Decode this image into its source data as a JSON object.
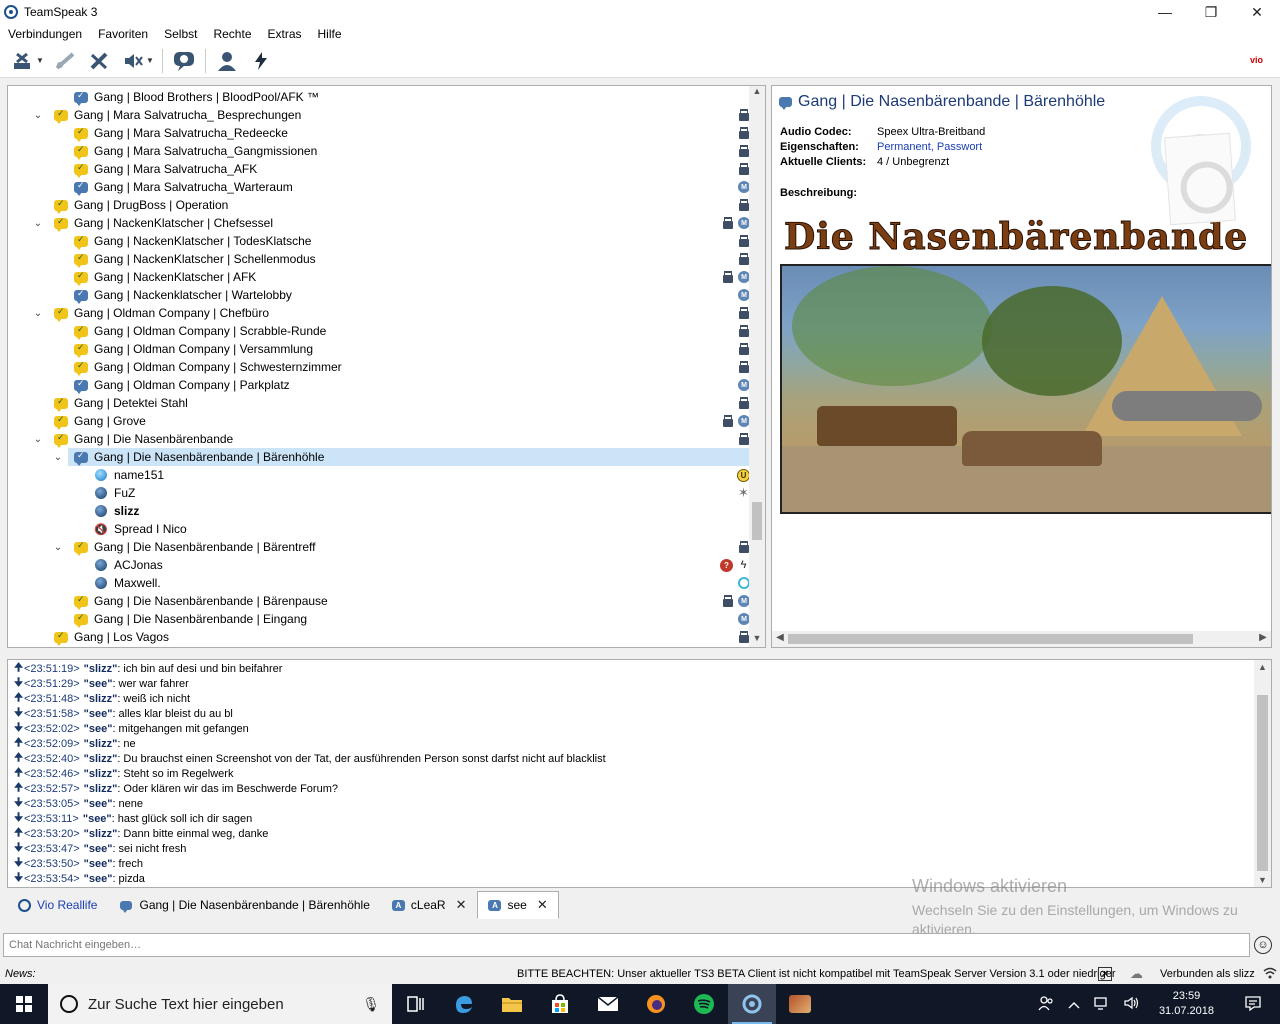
{
  "window": {
    "title": "TeamSpeak 3",
    "minimize": "—",
    "maximize": "❐",
    "close": "✕"
  },
  "menu": [
    "Verbindungen",
    "Favoriten",
    "Selbst",
    "Rechte",
    "Extras",
    "Hilfe"
  ],
  "toolbar": {
    "icons": [
      "disconnect-icon",
      "server-connect-icon",
      "mute-microphone-icon",
      "mute-speakers-icon",
      "away-icon",
      "contacts-icon",
      "whisper-icon"
    ],
    "logo_text": "vio"
  },
  "tree": {
    "rows": [
      {
        "kind": "channel",
        "label": "Gang | Blood Brothers | BloodPool/AFK ™",
        "level": 2,
        "icon": "blue",
        "toggle": "",
        "flags": []
      },
      {
        "kind": "channel",
        "label": "Gang | Mara Salvatrucha_ Besprechungen",
        "level": 1,
        "icon": "yellow",
        "toggle": "⌄",
        "flags": [
          "lock"
        ]
      },
      {
        "kind": "channel",
        "label": "Gang | Mara Salvatrucha_Redeecke",
        "level": 2,
        "icon": "yellow",
        "toggle": "",
        "flags": [
          "lock"
        ]
      },
      {
        "kind": "channel",
        "label": "Gang | Mara Salvatrucha_Gangmissionen",
        "level": 2,
        "icon": "yellow",
        "toggle": "",
        "flags": [
          "lock"
        ]
      },
      {
        "kind": "channel",
        "label": "Gang | Mara Salvatrucha_AFK",
        "level": 2,
        "icon": "yellow",
        "toggle": "",
        "flags": [
          "lock"
        ]
      },
      {
        "kind": "channel",
        "label": "Gang | Mara Salvatrucha_Warteraum",
        "level": 2,
        "icon": "blue",
        "toggle": "",
        "flags": [
          "mod"
        ]
      },
      {
        "kind": "channel",
        "label": "Gang | DrugBoss | Operation",
        "level": 1,
        "icon": "yellow",
        "toggle": "",
        "flags": [
          "lock"
        ]
      },
      {
        "kind": "channel",
        "label": "Gang | NackenKlatscher | Chefsessel",
        "level": 1,
        "icon": "yellow",
        "toggle": "⌄",
        "flags": [
          "lock",
          "mod"
        ]
      },
      {
        "kind": "channel",
        "label": "Gang | NackenKlatscher | TodesKlatsche",
        "level": 2,
        "icon": "yellow",
        "toggle": "",
        "flags": [
          "lock"
        ]
      },
      {
        "kind": "channel",
        "label": "Gang | NackenKlatscher | Schellenmodus",
        "level": 2,
        "icon": "yellow",
        "toggle": "",
        "flags": [
          "lock"
        ]
      },
      {
        "kind": "channel",
        "label": "Gang | NackenKlatscher | AFK",
        "level": 2,
        "icon": "yellow",
        "toggle": "",
        "flags": [
          "lock",
          "mod"
        ]
      },
      {
        "kind": "channel",
        "label": "Gang | Nackenklatscher | Wartelobby",
        "level": 2,
        "icon": "blue",
        "toggle": "",
        "flags": [
          "mod"
        ]
      },
      {
        "kind": "channel",
        "label": "Gang | Oldman Company | Chefbüro",
        "level": 1,
        "icon": "yellow",
        "toggle": "⌄",
        "flags": [
          "lock"
        ]
      },
      {
        "kind": "channel",
        "label": "Gang | Oldman Company | Scrabble-Runde",
        "level": 2,
        "icon": "yellow",
        "toggle": "",
        "flags": [
          "lock"
        ]
      },
      {
        "kind": "channel",
        "label": "Gang | Oldman Company | Versammlung",
        "level": 2,
        "icon": "yellow",
        "toggle": "",
        "flags": [
          "lock"
        ]
      },
      {
        "kind": "channel",
        "label": "Gang | Oldman Company | Schwesternzimmer",
        "level": 2,
        "icon": "yellow",
        "toggle": "",
        "flags": [
          "lock"
        ]
      },
      {
        "kind": "channel",
        "label": "Gang | Oldman Company | Parkplatz",
        "level": 2,
        "icon": "blue",
        "toggle": "",
        "flags": [
          "mod"
        ]
      },
      {
        "kind": "channel",
        "label": "Gang | Detektei Stahl",
        "level": 1,
        "icon": "yellow",
        "toggle": "",
        "flags": [
          "lock"
        ]
      },
      {
        "kind": "channel",
        "label": "Gang | Grove",
        "level": 1,
        "icon": "yellow",
        "toggle": "",
        "flags": [
          "lock",
          "mod"
        ]
      },
      {
        "kind": "channel",
        "label": "Gang | Die Nasenbärenbande",
        "level": 1,
        "icon": "yellow",
        "toggle": "⌄",
        "flags": [
          "lock"
        ]
      },
      {
        "kind": "channel",
        "label": "Gang | Die Nasenbärenbande | Bärenhöhle",
        "level": 2,
        "icon": "blue",
        "toggle": "⌄",
        "flags": [
          "lock"
        ],
        "selected": true
      },
      {
        "kind": "user",
        "label": "name151",
        "level": 3,
        "icon": "active",
        "bold": false,
        "flags": [
          "cmd"
        ]
      },
      {
        "kind": "user",
        "label": "FuZ",
        "level": 3,
        "icon": "normal",
        "bold": false,
        "flags": [
          "star"
        ]
      },
      {
        "kind": "user",
        "label": "slizz",
        "level": 3,
        "icon": "normal",
        "bold": true,
        "flags": []
      },
      {
        "kind": "user",
        "label": "Spread I Nico",
        "level": 3,
        "icon": "away",
        "bold": false,
        "flags": []
      },
      {
        "kind": "channel",
        "label": "Gang | Die Nasenbärenbande | Bärentreff",
        "level": 2,
        "icon": "yellow",
        "toggle": "⌄",
        "flags": [
          "lock"
        ]
      },
      {
        "kind": "user",
        "label": "ACJonas",
        "level": 3,
        "icon": "normal",
        "bold": false,
        "flags": [
          "red",
          "bolt"
        ]
      },
      {
        "kind": "user",
        "label": "Maxwell.",
        "level": 3,
        "icon": "normal",
        "bold": false,
        "flags": [
          "cyan"
        ]
      },
      {
        "kind": "channel",
        "label": "Gang | Die Nasenbärenbande | Bärenpause",
        "level": 2,
        "icon": "yellow",
        "toggle": "",
        "flags": [
          "lock",
          "mod"
        ]
      },
      {
        "kind": "channel",
        "label": "Gang | Die Nasenbärenbande | Eingang",
        "level": 2,
        "icon": "yellow",
        "toggle": "",
        "flags": [
          "mod"
        ]
      },
      {
        "kind": "channel",
        "label": "Gang | Los Vagos",
        "level": 1,
        "icon": "yellow",
        "toggle": "",
        "flags": [
          "lock"
        ]
      }
    ]
  },
  "info": {
    "channel_title": "Gang | Die Nasenbärenbande | Bärenhöhle",
    "audio_codec_label": "Audio Codec:",
    "audio_codec_value": "Speex Ultra-Breitband",
    "properties_label": "Eigenschaften:",
    "properties_value": "Permanent, Passwort",
    "clients_label": "Aktuelle Clients:",
    "clients_value": "4 / Unbegrenzt",
    "description_label": "Beschreibung:",
    "banner_text": "Die Nasenbärenbande"
  },
  "chat": {
    "messages": [
      {
        "dir": "out",
        "time": "<23:51:19>",
        "who": "\"slizz\"",
        "text": "ich bin auf desi und bin beifahrer"
      },
      {
        "dir": "in",
        "time": "<23:51:29>",
        "who": "\"see\"",
        "text": "wer war fahrer"
      },
      {
        "dir": "out",
        "time": "<23:51:48>",
        "who": "\"slizz\"",
        "text": "weiß ich nicht"
      },
      {
        "dir": "in",
        "time": "<23:51:58>",
        "who": "\"see\"",
        "text": "alles klar bleist du au bl"
      },
      {
        "dir": "in",
        "time": "<23:52:02>",
        "who": "\"see\"",
        "text": "mitgehangen mit gefangen"
      },
      {
        "dir": "out",
        "time": "<23:52:09>",
        "who": "\"slizz\"",
        "text": "ne"
      },
      {
        "dir": "out",
        "time": "<23:52:40>",
        "who": "\"slizz\"",
        "text": "Du brauchst einen Screenshot von der Tat, der ausführenden Person sonst darfst nicht auf blacklist"
      },
      {
        "dir": "out",
        "time": "<23:52:46>",
        "who": "\"slizz\"",
        "text": "Steht so im Regelwerk"
      },
      {
        "dir": "out",
        "time": "<23:52:57>",
        "who": "\"slizz\"",
        "text": "Oder klären wir das im Beschwerde Forum?"
      },
      {
        "dir": "in",
        "time": "<23:53:05>",
        "who": "\"see\"",
        "text": "nene"
      },
      {
        "dir": "in",
        "time": "<23:53:11>",
        "who": "\"see\"",
        "text": "hast glück soll ich dir sagen"
      },
      {
        "dir": "out",
        "time": "<23:53:20>",
        "who": "\"slizz\"",
        "text": "Dann bitte einmal weg, danke"
      },
      {
        "dir": "in",
        "time": "<23:53:47>",
        "who": "\"see\"",
        "text": "sei nicht fresh"
      },
      {
        "dir": "in",
        "time": "<23:53:50>",
        "who": "\"see\"",
        "text": "frech"
      },
      {
        "dir": "in",
        "time": "<23:53:54>",
        "who": "\"see\"",
        "text": "pizda"
      }
    ],
    "arrow_out": "🠉",
    "arrow_in": "🠋"
  },
  "watermark": {
    "line1": "Windows aktivieren",
    "line2": "Wechseln Sie zu den Einstellungen, um Windows zu aktivieren."
  },
  "tabs": [
    {
      "label": "Vio Reallife",
      "icon": "server",
      "closable": false,
      "active": false
    },
    {
      "label": "Gang | Die Nasenbärenbande | Bärenhöhle",
      "icon": "channel",
      "closable": false,
      "active": false
    },
    {
      "label": "cLeaR",
      "icon": "user",
      "closable": true,
      "active": false
    },
    {
      "label": "see",
      "icon": "user",
      "closable": true,
      "active": true
    }
  ],
  "chat_input": {
    "placeholder": "Chat Nachricht eingeben…"
  },
  "status": {
    "news_label": "News:",
    "notice": "BITTE BEACHTEN: Unser aktueller TS3 BETA Client ist nicht kompatibel mit TeamSpeak Server Version 3.1 oder niedriger",
    "connected": "Verbunden als slizz"
  },
  "taskbar": {
    "search_placeholder": "Zur Suche Text hier eingeben",
    "time": "23:59",
    "date": "31.07.2018"
  }
}
